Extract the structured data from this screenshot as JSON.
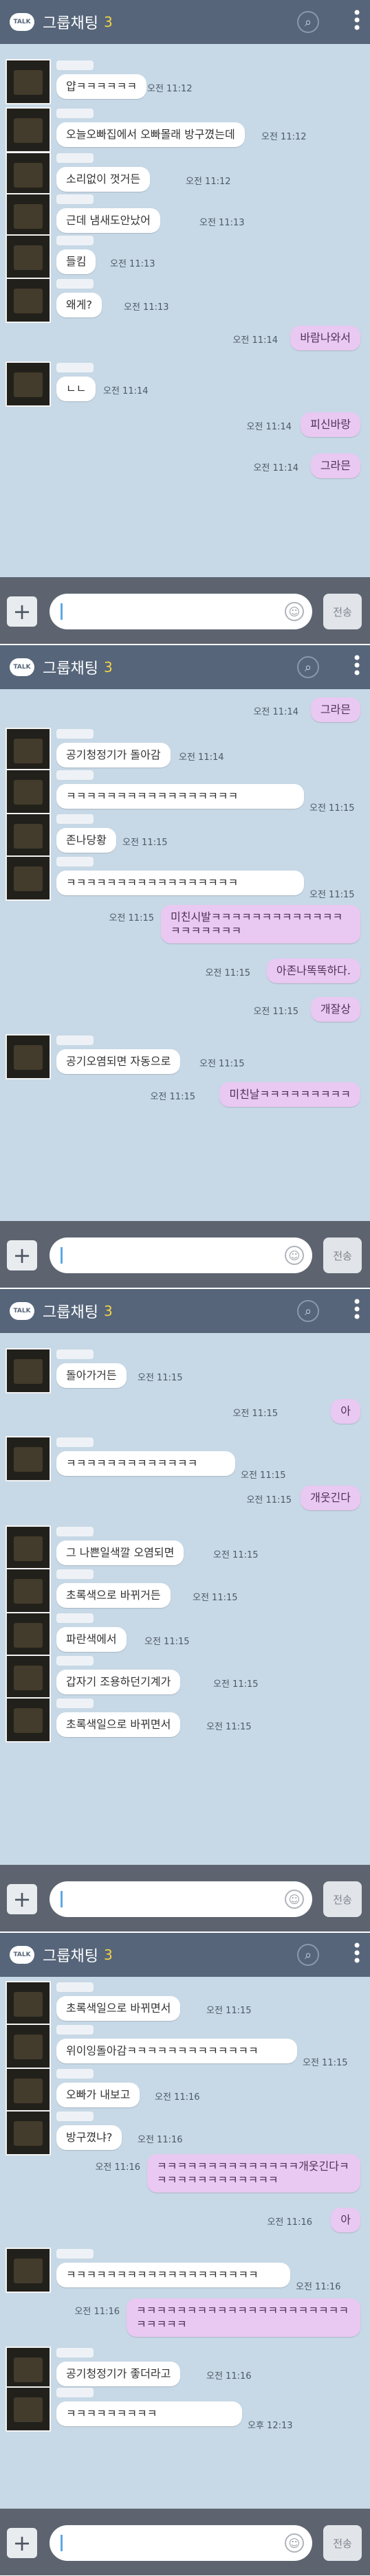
{
  "app": {
    "logo": "TALK",
    "title": "그룹채팅",
    "member_count": "3",
    "input_placeholder": "",
    "send_label": "전송",
    "icons": {
      "logo": "kakaotalk-logo",
      "search": "search-icon",
      "menu": "more-vertical-icon",
      "plus": "plus-icon",
      "emoticon": "emoticon-icon"
    },
    "colors": {
      "header": "#56657a",
      "chat_bg": "#c7d8e6",
      "my_bubble": "#e9c8f2",
      "their_bubble": "#ffffff",
      "count": "#f2d347"
    }
  },
  "screens": [
    {
      "messages": [
        {
          "side": "left",
          "text": "얍ㅋㅋㅋㅋㅋㅋ",
          "time": "오전 11:12"
        },
        {
          "side": "left",
          "text": "오늘오빠집에서 오빠몰래 방구꼈는데",
          "time": "오전 11:12"
        },
        {
          "side": "left",
          "text": "소리없이 껏거든",
          "time": "오전 11:12"
        },
        {
          "side": "left",
          "text": "근데 냄새도안났어",
          "time": "오전 11:13"
        },
        {
          "side": "left",
          "text": "들킴",
          "time": "오전 11:13"
        },
        {
          "side": "left",
          "text": "왜게?",
          "time": "오전 11:13"
        },
        {
          "side": "right",
          "text": "바람나와서",
          "time": "오전 11:14"
        },
        {
          "side": "left",
          "text": "ㄴㄴ",
          "time": "오전 11:14"
        },
        {
          "side": "right",
          "text": "피신바랑",
          "time": "오전 11:14"
        },
        {
          "side": "right",
          "text": "그라믄",
          "time": "오전 11:14"
        }
      ]
    },
    {
      "messages": [
        {
          "side": "right",
          "text": "그라믄",
          "time": "오전 11:14"
        },
        {
          "side": "left",
          "text": "공기청정기가 돌아감",
          "time": "오전 11:14"
        },
        {
          "side": "left",
          "text": "ㅋㅋㅋㅋㅋㅋㅋㅋㅋㅋㅋㅋㅋㅋㅋㅋㅋ",
          "time": "오전 11:15"
        },
        {
          "side": "left",
          "text": "존나당황",
          "time": "오전 11:15"
        },
        {
          "side": "left",
          "text": "ㅋㅋㅋㅋㅋㅋㅋㅋㅋㅋㅋㅋㅋㅋㅋㅋㅋ",
          "time": "오전 11:15"
        },
        {
          "side": "right",
          "text": "미친시발ㅋㅋㅋㅋㅋㅋㅋㅋㅋㅋㅋㅋㅋㅋㅋㅋㅋㅋㅋㅋ",
          "time": "오전 11:15"
        },
        {
          "side": "right",
          "text": "아존나똑똑하다.",
          "time": "오전 11:15"
        },
        {
          "side": "right",
          "text": "개잘상",
          "time": "오전 11:15"
        },
        {
          "side": "left",
          "text": "공기오염되면 자동으로",
          "time": "오전 11:15"
        },
        {
          "side": "right",
          "text": "미친날ㅋㅋㅋㅋㅋㅋㅋㅋㅋ",
          "time": "오전 11:15"
        }
      ]
    },
    {
      "messages": [
        {
          "side": "left",
          "text": "돌아가거든",
          "time": "오전 11:15"
        },
        {
          "side": "right",
          "text": "아",
          "time": "오전 11:15"
        },
        {
          "side": "left",
          "text": "ㅋㅋㅋㅋㅋㅋㅋㅋㅋㅋㅋㅋㅋ",
          "time": "오전 11:15"
        },
        {
          "side": "right",
          "text": "개웃긴다",
          "time": "오전 11:15"
        },
        {
          "side": "left",
          "text": "그 나쁜일색깔 오염되면",
          "time": "오전 11:15"
        },
        {
          "side": "left",
          "text": "초록색으로 바뀌거든",
          "time": "오전 11:15"
        },
        {
          "side": "left",
          "text": "파란색에서",
          "time": "오전 11:15"
        },
        {
          "side": "left",
          "text": "갑자기 조용하던기계가",
          "time": "오전 11:15"
        },
        {
          "side": "left",
          "text": "초록색일으로 바뀌면서",
          "time": "오전 11:15"
        }
      ]
    },
    {
      "messages": [
        {
          "side": "left",
          "text": "초록색일으로 바뀌면서",
          "time": "오전 11:15"
        },
        {
          "side": "left",
          "text": "위이잉돌아감ㅋㅋㅋㅋㅋㅋㅋㅋㅋㅋㅋㅋㅋ",
          "time": "오전 11:15"
        },
        {
          "side": "left",
          "text": "오빠가 내보고",
          "time": "오전 11:16"
        },
        {
          "side": "left",
          "text": "방구꼈냐?",
          "time": "오전 11:16"
        },
        {
          "side": "right",
          "text": "ㅋㅋㅋㅋㅋㅋㅋㅋㅋㅋㅋㅋㅋㅋ개웃긴다ㅋㅋㅋㅋㅋㅋㅋㅋㅋㅋㅋㅋㅋ",
          "time": "오전 11:16"
        },
        {
          "side": "right",
          "text": "아",
          "time": "오전 11:16"
        },
        {
          "side": "left",
          "text": "ㅋㅋㅋㅋㅋㅋㅋㅋㅋㅋㅋㅋㅋㅋㅋㅋㅋㅋㅋ",
          "time": "오전 11:16"
        },
        {
          "side": "right",
          "text": "ㅋㅋㅋㅋㅋㅋㅋㅋㅋㅋㅋㅋㅋㅋㅋㅋㅋㅋㅋㅋㅋㅋㅋㅋㅋㅋ",
          "time": "오전 11:16"
        },
        {
          "side": "left",
          "text": "공기청정기가 좋더라고",
          "time": "오전 11:16"
        },
        {
          "side": "left",
          "text": "ㅋㅋㅋㅋㅋㅋㅋㅋㅋ",
          "time": "오후 12:13"
        }
      ]
    }
  ]
}
